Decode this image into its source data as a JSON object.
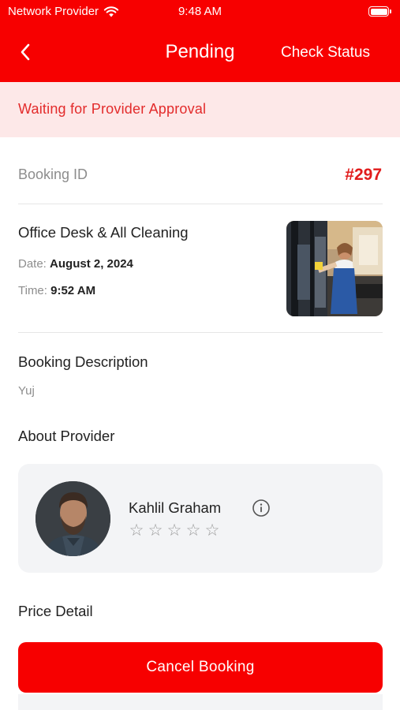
{
  "status_bar": {
    "carrier": "Network Provider",
    "time": "9:48 AM"
  },
  "nav": {
    "title": "Pending",
    "action_label": "Check Status"
  },
  "banner": {
    "text": "Waiting for Provider Approval"
  },
  "booking": {
    "id_label": "Booking ID",
    "id_value": "#297",
    "service_name": "Office Desk & All Cleaning",
    "date_label": "Date:",
    "date_value": "August 2, 2024",
    "time_label": "Time:",
    "time_value": "9:52 AM"
  },
  "description": {
    "title": "Booking Description",
    "text": "Yuj"
  },
  "provider": {
    "section_title": "About Provider",
    "name": "Kahlil Graham",
    "rating": 0,
    "max_rating": 5
  },
  "price": {
    "section_title": "Price Detail"
  },
  "actions": {
    "cancel_label": "Cancel Booking"
  },
  "colors": {
    "brand": "#f70000",
    "banner_bg": "#fde8e8",
    "banner_text": "#e32b2b",
    "card_bg": "#f3f4f6"
  },
  "icons": {
    "back": "chevron-left-icon",
    "wifi": "wifi-icon",
    "battery": "battery-icon",
    "info": "info-icon",
    "star": "star-outline-icon"
  }
}
